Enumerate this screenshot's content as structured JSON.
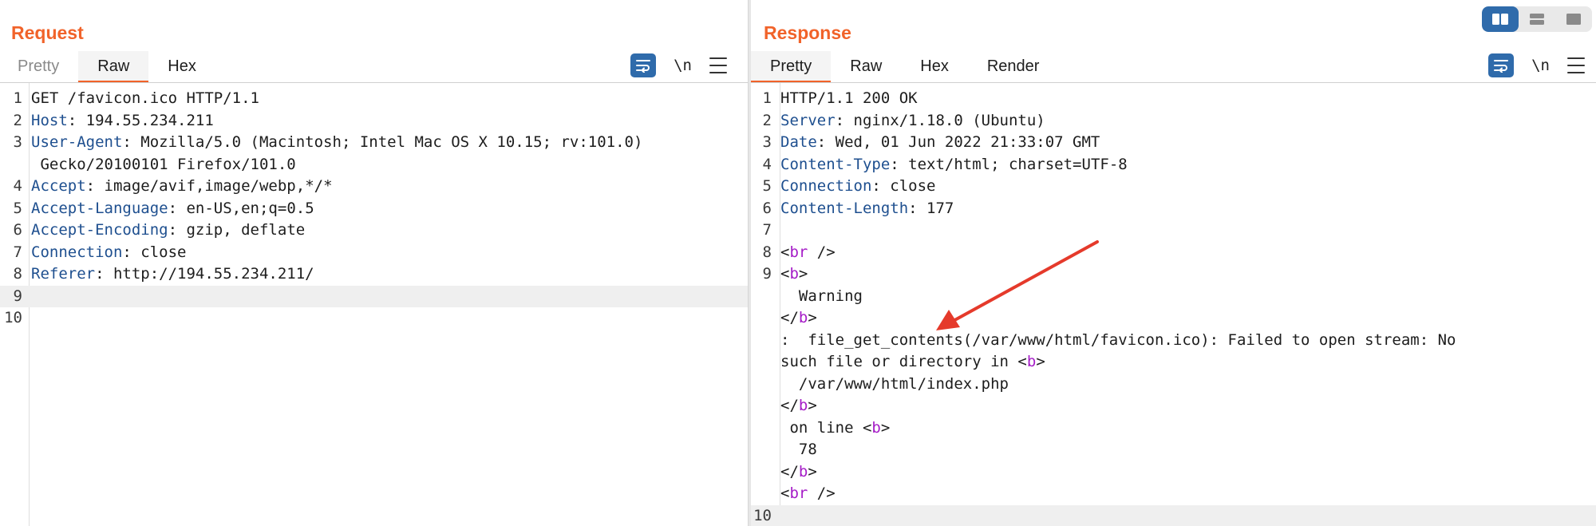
{
  "request": {
    "title": "Request",
    "tabs": [
      {
        "label": "Pretty",
        "active": false
      },
      {
        "label": "Raw",
        "active": true
      },
      {
        "label": "Hex",
        "active": false
      }
    ],
    "newline_label": "\\n",
    "lines": [
      {
        "n": "1",
        "key": "",
        "sep": "",
        "val": "GET /favicon.ico HTTP/1.1"
      },
      {
        "n": "2",
        "key": "Host",
        "sep": ": ",
        "val": "194.55.234.211"
      },
      {
        "n": "3",
        "key": "User-Agent",
        "sep": ": ",
        "val": "Mozilla/5.0 (Macintosh; Intel Mac OS X 10.15; rv:101.0)"
      },
      {
        "n": "",
        "key": "",
        "sep": "",
        "val": " Gecko/20100101 Firefox/101.0"
      },
      {
        "n": "4",
        "key": "Accept",
        "sep": ": ",
        "val": "image/avif,image/webp,*/*"
      },
      {
        "n": "5",
        "key": "Accept-Language",
        "sep": ": ",
        "val": "en-US,en;q=0.5"
      },
      {
        "n": "6",
        "key": "Accept-Encoding",
        "sep": ": ",
        "val": "gzip, deflate"
      },
      {
        "n": "7",
        "key": "Connection",
        "sep": ": ",
        "val": "close"
      },
      {
        "n": "8",
        "key": "Referer",
        "sep": ": ",
        "val": "http://194.55.234.211/"
      },
      {
        "n": "9",
        "key": "",
        "sep": "",
        "val": "",
        "highlight": true
      },
      {
        "n": "10",
        "key": "",
        "sep": "",
        "val": ""
      }
    ]
  },
  "response": {
    "title": "Response",
    "tabs": [
      {
        "label": "Pretty",
        "active": true
      },
      {
        "label": "Raw",
        "active": false
      },
      {
        "label": "Hex",
        "active": false
      },
      {
        "label": "Render",
        "active": false
      }
    ],
    "newline_label": "\\n",
    "lines": [
      {
        "n": "1",
        "parts": [
          {
            "t": "HTTP/1.1 200 OK"
          }
        ]
      },
      {
        "n": "2",
        "parts": [
          {
            "t": "Server",
            "c": "hk"
          },
          {
            "t": ": nginx/1.18.0 (Ubuntu)"
          }
        ]
      },
      {
        "n": "3",
        "parts": [
          {
            "t": "Date",
            "c": "hk"
          },
          {
            "t": ": Wed, 01 Jun 2022 21:33:07 GMT"
          }
        ]
      },
      {
        "n": "4",
        "parts": [
          {
            "t": "Content-Type",
            "c": "hk"
          },
          {
            "t": ": text/html; charset=UTF-8"
          }
        ]
      },
      {
        "n": "5",
        "parts": [
          {
            "t": "Connection",
            "c": "hk"
          },
          {
            "t": ": close"
          }
        ]
      },
      {
        "n": "6",
        "parts": [
          {
            "t": "Content-Length",
            "c": "hk"
          },
          {
            "t": ": 177"
          }
        ]
      },
      {
        "n": "7",
        "parts": []
      },
      {
        "n": "8",
        "parts": [
          {
            "t": "<"
          },
          {
            "t": "br",
            "c": "tg"
          },
          {
            "t": " />"
          }
        ]
      },
      {
        "n": "9",
        "parts": [
          {
            "t": "<"
          },
          {
            "t": "b",
            "c": "tg"
          },
          {
            "t": ">"
          }
        ]
      },
      {
        "n": "",
        "parts": [
          {
            "t": "  Warning"
          }
        ]
      },
      {
        "n": "",
        "parts": [
          {
            "t": "</"
          },
          {
            "t": "b",
            "c": "tg"
          },
          {
            "t": ">"
          }
        ]
      },
      {
        "n": "",
        "parts": [
          {
            "t": ":  file_get_contents(/var/www/html/favicon.ico): Failed to open stream: No"
          }
        ]
      },
      {
        "n": "",
        "parts": [
          {
            "t": "such file or directory in <"
          },
          {
            "t": "b",
            "c": "tg"
          },
          {
            "t": ">"
          }
        ]
      },
      {
        "n": "",
        "parts": [
          {
            "t": "  /var/www/html/index.php"
          }
        ]
      },
      {
        "n": "",
        "parts": [
          {
            "t": "</"
          },
          {
            "t": "b",
            "c": "tg"
          },
          {
            "t": ">"
          }
        ]
      },
      {
        "n": "",
        "parts": [
          {
            "t": " on line <"
          },
          {
            "t": "b",
            "c": "tg"
          },
          {
            "t": ">"
          }
        ]
      },
      {
        "n": "",
        "parts": [
          {
            "t": "  78"
          }
        ]
      },
      {
        "n": "",
        "parts": [
          {
            "t": "</"
          },
          {
            "t": "b",
            "c": "tg"
          },
          {
            "t": ">"
          }
        ]
      },
      {
        "n": "",
        "parts": [
          {
            "t": "<"
          },
          {
            "t": "br",
            "c": "tg"
          },
          {
            "t": " />"
          }
        ]
      },
      {
        "n": "10",
        "parts": [],
        "highlight": true
      }
    ]
  },
  "colors": {
    "accent": "#f1632a",
    "header_key": "#1e4f8f",
    "tag": "#a51cc7",
    "button_blue": "#2f6bab",
    "annotation_arrow": "#e53a2b"
  },
  "icons": {
    "wrap": "wrap-lines-icon",
    "menu": "hamburger-menu-icon",
    "layout_split": "layout-side-by-side-icon",
    "layout_stacked": "layout-stacked-icon",
    "layout_single": "layout-single-icon",
    "annotation": "red-arrow-annotation"
  }
}
